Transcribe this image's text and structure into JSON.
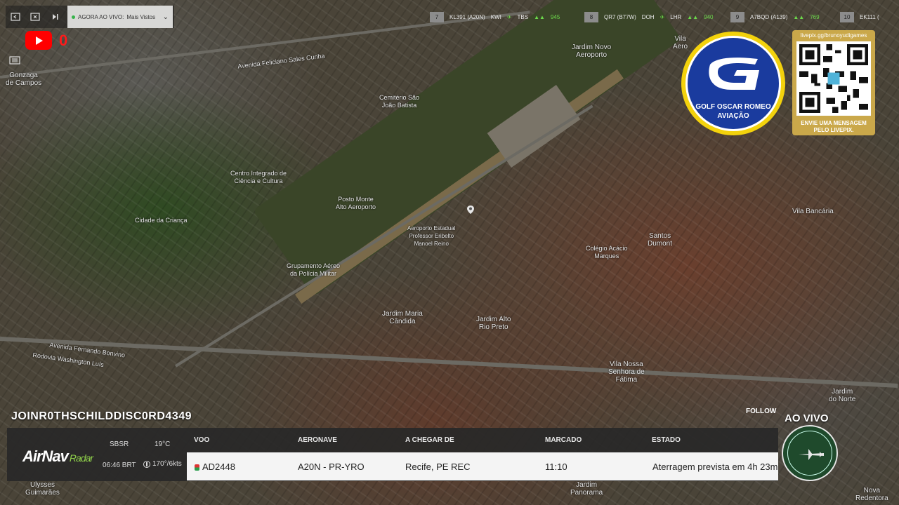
{
  "topbar": {
    "now_live_label": "AGORA AO VIVO:",
    "now_live_value": "Mais Vistos",
    "flights": [
      {
        "rank": "7",
        "callsign": "KL391 (A20N)",
        "from": "KWI",
        "to": "TBS",
        "alt": "945"
      },
      {
        "rank": "8",
        "callsign": "QR7 (B77W)",
        "from": "DOH",
        "to": "LHR",
        "alt": "940"
      },
      {
        "rank": "9",
        "callsign": "A7BQD (A139)",
        "from": "",
        "to": "",
        "alt": "769"
      },
      {
        "rank": "10",
        "callsign": "EK111 (",
        "from": "",
        "to": "",
        "alt": ""
      }
    ]
  },
  "social": {
    "youtube_count": "0"
  },
  "map": {
    "places": {
      "gonzaga": "Gonzaga\nde Campos",
      "jardim_novo": "Jardim Novo\nAeroporto",
      "vila_aero": "Vila\nAero",
      "vila_bancaria": "Vila Bancária",
      "santos_dumont": "Santos\nDumont",
      "airport": "Aeroporto Estadual\nProfessor Eribelto\nManoel Reino",
      "jardim_maria": "Jardim Maria\nCândida",
      "jardim_alto": "Jardim Alto\nRio Preto",
      "vila_nossa": "Vila Nossa\nSenhora de\nFátima",
      "jardim_norte": "Jardim\ndo Norte",
      "cidade_crianca": "Cidade da Criança",
      "centro_integrado": "Centro Integrado de\nCiência e Cultura",
      "grupamento": "Grupamento Aéreo\nda Polícia Militar",
      "cemiterio": "Cemitério São\nJoão Batista",
      "posto": "Posto Monte\nAlto Aeroporto",
      "colegio": "Colégio Acácio\nMarques",
      "ulysses": "Ulysses\nGuimarães",
      "jardim_panorama": "Jardim\nPanorama",
      "nova_redentora": "Nova\nRedentora",
      "av_feliciano": "Avenida Feliciano Sales Cunha",
      "av_fernando": "Avenida Fernando Bonvino",
      "rodovia": "Rodovia Washington Luís"
    }
  },
  "badge": {
    "line1": "GOLF OSCAR ROMEO",
    "line2": "AVIAÇÃO"
  },
  "qr": {
    "url": "livepix.gg/brunoyudigames",
    "message": "ENVIE UMA MENSAGEM\nPELO LIVEPIX."
  },
  "bottom": {
    "channel": "JOINR0THSCHILDDISC0RD4349",
    "follow": "FOLLOW",
    "live": "AO VIVO",
    "brand": "AirNav",
    "brand_sub": "Radar",
    "icao": "SBSR",
    "local_time": "06:46 BRT",
    "temperature": "19°C",
    "wind": "170°/6kts",
    "headers": {
      "flight": "VOO",
      "aircraft": "AERONAVE",
      "arriving_from": "A CHEGAR DE",
      "scheduled": "MARCADO",
      "status": "ESTADO"
    },
    "row": {
      "flight": "AD2448",
      "aircraft": "A20N - PR-YRO",
      "arriving_from": "Recife, PE REC",
      "scheduled": "11:10",
      "status": "Aterragem prevista em 4h 23m"
    }
  }
}
